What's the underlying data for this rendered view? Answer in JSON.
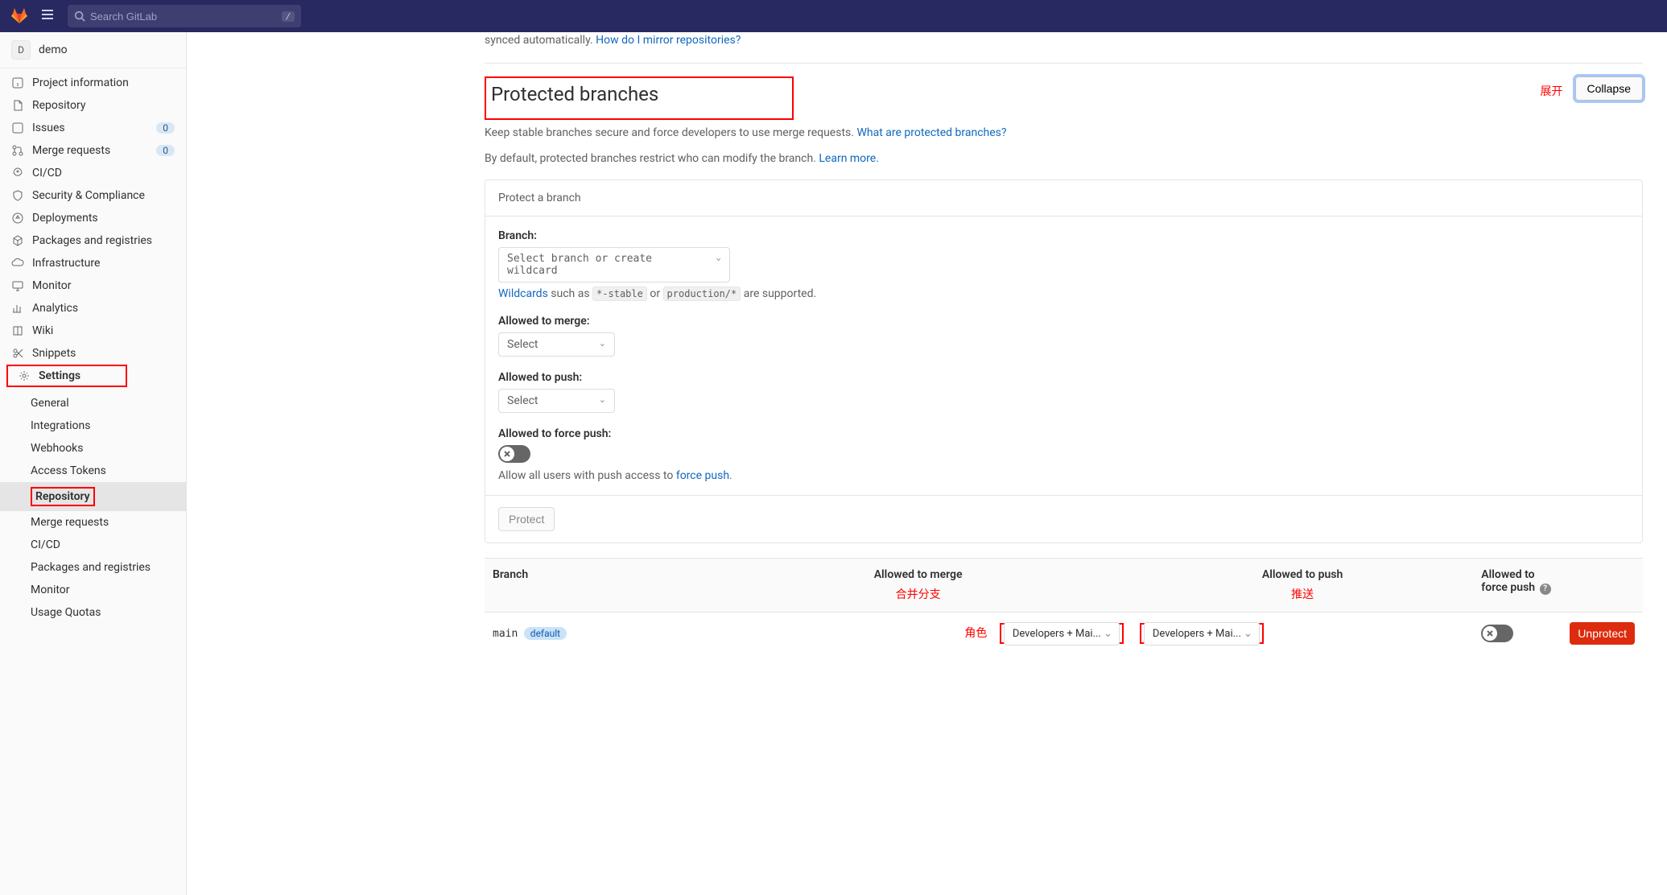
{
  "search": {
    "placeholder": "Search GitLab",
    "shortcut": "/"
  },
  "project": {
    "initial": "D",
    "name": "demo"
  },
  "sidebar": {
    "items": [
      {
        "label": "Project information"
      },
      {
        "label": "Repository"
      },
      {
        "label": "Issues",
        "badge": "0"
      },
      {
        "label": "Merge requests",
        "badge": "0"
      },
      {
        "label": "CI/CD"
      },
      {
        "label": "Security & Compliance"
      },
      {
        "label": "Deployments"
      },
      {
        "label": "Packages and registries"
      },
      {
        "label": "Infrastructure"
      },
      {
        "label": "Monitor"
      },
      {
        "label": "Analytics"
      },
      {
        "label": "Wiki"
      },
      {
        "label": "Snippets"
      },
      {
        "label": "Settings"
      }
    ],
    "settings_sub": [
      "General",
      "Integrations",
      "Webhooks",
      "Access Tokens",
      "Repository",
      "Merge requests",
      "CI/CD",
      "Packages and registries",
      "Monitor",
      "Usage Quotas"
    ]
  },
  "mirror": {
    "tail": "synced automatically.",
    "link": "How do I mirror repositories?"
  },
  "section": {
    "title": "Protected branches",
    "expand_cn": "展开",
    "collapse": "Collapse",
    "desc_pre": "Keep stable branches secure and force developers to use merge requests.",
    "desc_link": "What are protected branches?",
    "default_pre": "By default, protected branches restrict who can modify the branch.",
    "default_link": "Learn more."
  },
  "card": {
    "header": "Protect a branch",
    "branch_label": "Branch:",
    "branch_placeholder": "Select branch or create wildcard",
    "wildcard_link": "Wildcards",
    "wildcard_mid1": " such as ",
    "wildcard_code1": "*-stable",
    "wildcard_mid2": " or ",
    "wildcard_code2": "production/*",
    "wildcard_tail": " are supported.",
    "merge_label": "Allowed to merge:",
    "push_label": "Allowed to push:",
    "select_placeholder": "Select",
    "force_label": "Allowed to force push:",
    "force_hint_pre": "Allow all users with push access to ",
    "force_hint_link": "force push",
    "force_hint_post": ".",
    "protect_btn": "Protect"
  },
  "table": {
    "headers": {
      "branch": "Branch",
      "merge": "Allowed to merge",
      "push": "Allowed to push",
      "force": "Allowed to force push"
    },
    "annot": {
      "merge": "合并分支",
      "push": "推送",
      "role": "角色"
    },
    "row": {
      "name": "main",
      "badge": "default",
      "merge_val": "Developers + Mai...",
      "push_val": "Developers + Mai...",
      "unprotect": "Unprotect"
    }
  }
}
